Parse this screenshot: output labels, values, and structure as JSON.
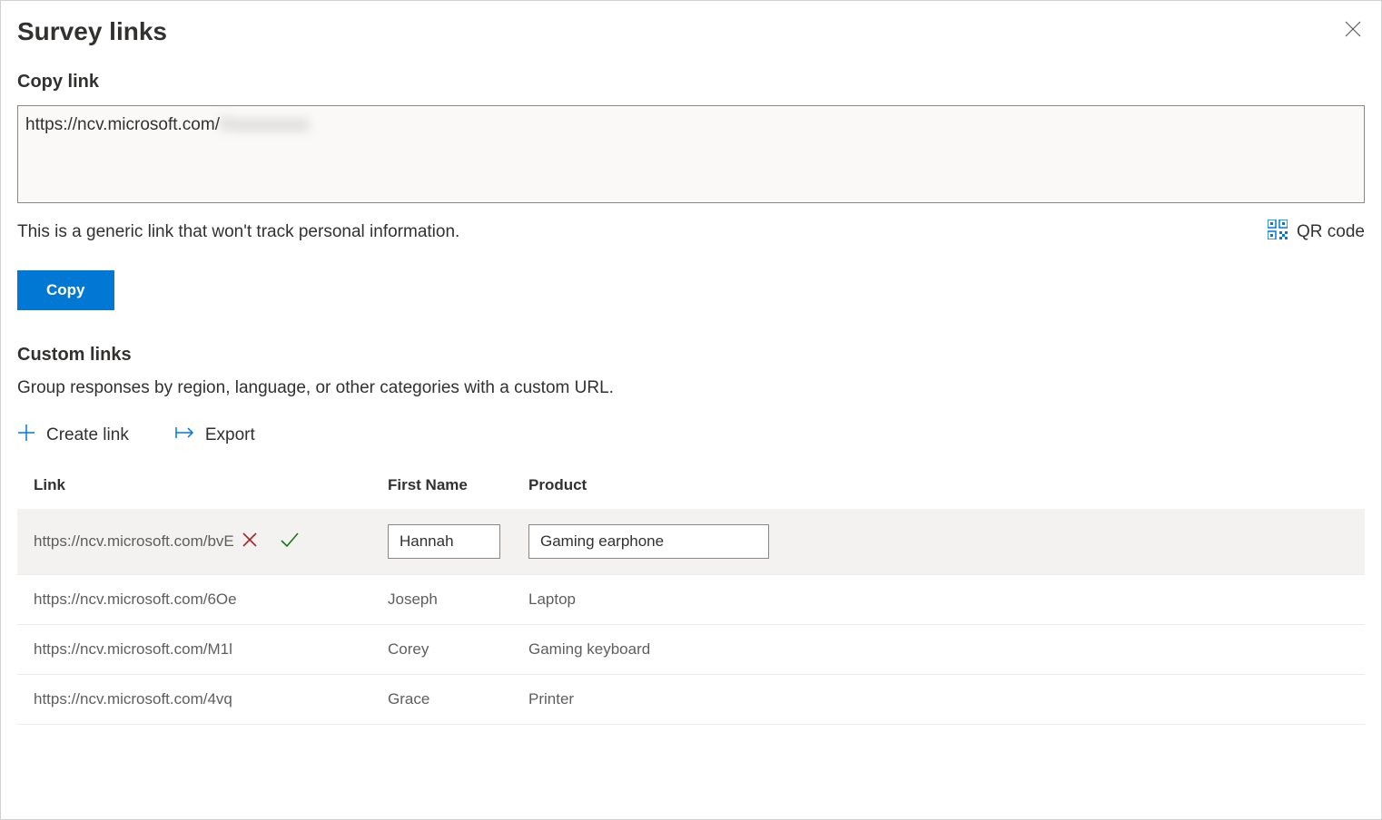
{
  "panel": {
    "title": "Survey links"
  },
  "copy_link": {
    "heading": "Copy link",
    "url_prefix": "https://ncv.microsoft.com/",
    "url_blurred": "Xxxxxxxxxx",
    "info": "This is a generic link that won't track personal information.",
    "qr_label": "QR code",
    "copy_button": "Copy"
  },
  "custom_links": {
    "heading": "Custom links",
    "description": "Group responses by region, language, or other categories with a custom URL.",
    "create_label": "Create link",
    "export_label": "Export"
  },
  "table": {
    "headers": {
      "link": "Link",
      "first_name": "First Name",
      "product": "Product"
    },
    "rows": [
      {
        "link": "https://ncv.microsoft.com/bvE",
        "first_name": "Hannah",
        "product": "Gaming earphone",
        "editing": true
      },
      {
        "link": "https://ncv.microsoft.com/6Oe",
        "first_name": "Joseph",
        "product": "Laptop",
        "editing": false
      },
      {
        "link": "https://ncv.microsoft.com/M1l",
        "first_name": "Corey",
        "product": "Gaming keyboard",
        "editing": false
      },
      {
        "link": "https://ncv.microsoft.com/4vq",
        "first_name": "Grace",
        "product": "Printer",
        "editing": false
      }
    ]
  }
}
